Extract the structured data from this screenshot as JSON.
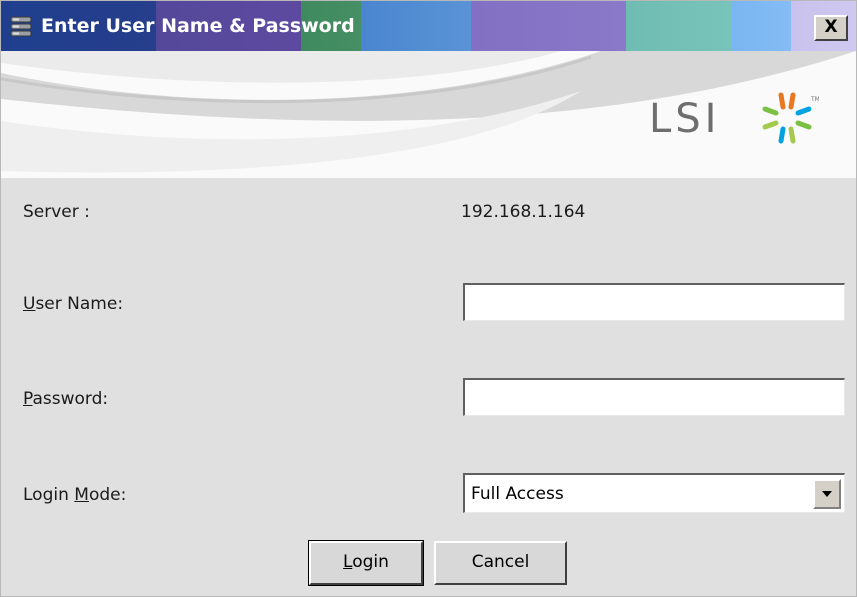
{
  "window": {
    "title": "Enter User Name & Password",
    "close_glyph": "X",
    "title_icon": "server-stack-icon"
  },
  "banner": {
    "logo_text": "LSI",
    "logo_icon": "lsi-starburst-icon"
  },
  "form": {
    "server_label": "Server :",
    "server_value": "192.168.1.164",
    "username_label_mnemonic": "U",
    "username_label_rest": "ser Name:",
    "username_value": "",
    "password_label_mnemonic": "P",
    "password_label_rest": "assword:",
    "password_value": "",
    "login_mode_label_prefix": "Login ",
    "login_mode_label_mnemonic": "M",
    "login_mode_label_rest": "ode:",
    "login_mode_value": "Full Access"
  },
  "buttons": {
    "login_mnemonic": "L",
    "login_rest": "ogin",
    "cancel": "Cancel"
  },
  "colors": {
    "dialog_background": "#e0e0e0",
    "logo_gray": "#6e6e6e",
    "logo_accents": [
      "#e87722",
      "#7ac143",
      "#00a3e0",
      "#a3c94f"
    ]
  }
}
